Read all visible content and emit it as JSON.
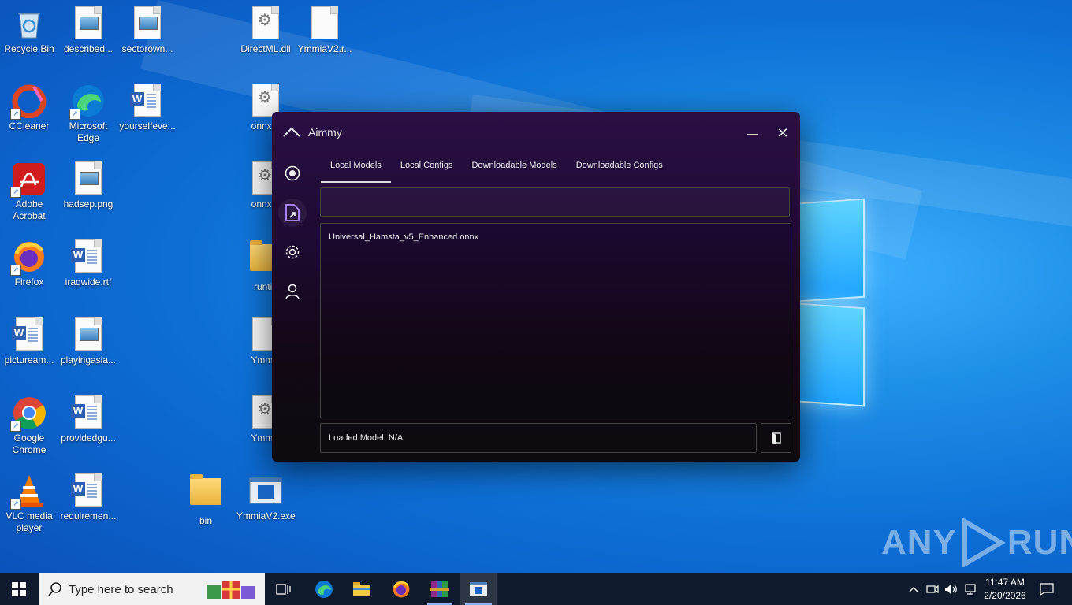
{
  "desktop": {
    "icons": [
      {
        "label": "Recycle Bin"
      },
      {
        "label": "described..."
      },
      {
        "label": "sectorown..."
      },
      {
        "label": "DirectML.dll"
      },
      {
        "label": "YmmiaV2.r..."
      },
      {
        "label": "CCleaner"
      },
      {
        "label": "Microsoft Edge"
      },
      {
        "label": "yourselfeve..."
      },
      {
        "label": "onnxru"
      },
      {
        "label": "Adobe Acrobat"
      },
      {
        "label": "hadsep.png"
      },
      {
        "label": "onnxru"
      },
      {
        "label": "Firefox"
      },
      {
        "label": "iraqwide.rtf"
      },
      {
        "label": "runtin"
      },
      {
        "label": "pictuream..."
      },
      {
        "label": "playingasia..."
      },
      {
        "label": "Ymmia"
      },
      {
        "label": "Google Chrome"
      },
      {
        "label": "providedgu..."
      },
      {
        "label": "Ymmia"
      },
      {
        "label": "VLC media player"
      },
      {
        "label": "requiremen..."
      },
      {
        "label": "bin"
      },
      {
        "label": "YmmiaV2.exe"
      }
    ]
  },
  "app": {
    "title": "Aimmy",
    "minimize_glyph": "—",
    "close_glyph": "✕",
    "tabs": [
      {
        "label": "Local Models"
      },
      {
        "label": "Local Configs"
      },
      {
        "label": "Downloadable Models"
      },
      {
        "label": "Downloadable Configs"
      }
    ],
    "search_value": "",
    "models": [
      "Universal_Hamsta_v5_Enhanced.onnx"
    ],
    "loaded_model": "Loaded Model: N/A"
  },
  "watermark": {
    "text_left": "ANY",
    "text_right": "RUN"
  },
  "taskbar": {
    "search_placeholder": "Type here to search",
    "time": "11:47 AM",
    "date": "2/20/2026"
  },
  "colors": {
    "desktop_blue": "#0d6fd6",
    "app_purple": "#2a0f44",
    "taskbar": "#0f1b2c"
  }
}
